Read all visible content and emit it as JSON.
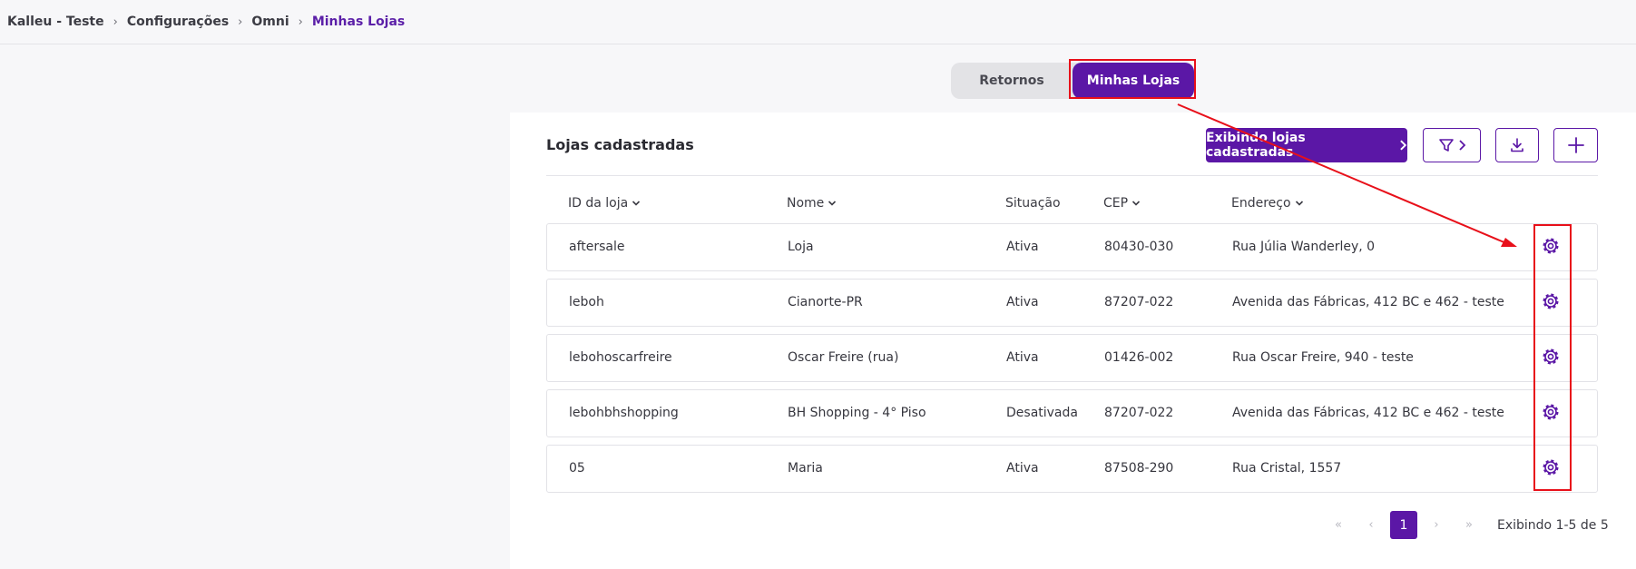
{
  "breadcrumb": [
    "Kalleu - Teste",
    "Configurações",
    "Omni",
    "Minhas Lojas"
  ],
  "tabs": [
    {
      "label": "Retornos"
    },
    {
      "label": "Minhas Lojas"
    }
  ],
  "panel": {
    "title": "Lojas cadastradas",
    "primary_button": "Exibindo lojas cadastradas",
    "filter_icon": "filter-icon",
    "download_icon": "download-icon",
    "add_icon": "plus-icon"
  },
  "table": {
    "headers": [
      "ID da loja",
      "Nome",
      "Situação",
      "CEP",
      "Endereço"
    ],
    "rows": [
      [
        "aftersale",
        "Loja",
        "Ativa",
        "80430-030",
        "Rua Júlia Wanderley, 0"
      ],
      [
        "leboh",
        "Cianorte-PR",
        "Ativa",
        "87207-022",
        "Avenida das Fábricas, 412 BC e 462 - teste"
      ],
      [
        "lebohoscarfreire",
        "Oscar Freire (rua)",
        "Ativa",
        "01426-002",
        "Rua Oscar Freire, 940 - teste"
      ],
      [
        "lebohbhshopping",
        "BH Shopping - 4° Piso",
        "Desativada",
        "87207-022",
        "Avenida das Fábricas, 412 BC e 462 - teste"
      ],
      [
        "05",
        "Maria",
        "Ativa",
        "87508-290",
        "Rua Cristal, 1557"
      ]
    ],
    "row_action_icon": "gear-icon"
  },
  "pagination": {
    "first": "«",
    "prev": "‹",
    "current": "1",
    "next": "›",
    "last": "»",
    "info": "Exibindo 1-5 de 5"
  },
  "colors": {
    "accent": "#5b17a6",
    "annotation": "#e8101a"
  }
}
